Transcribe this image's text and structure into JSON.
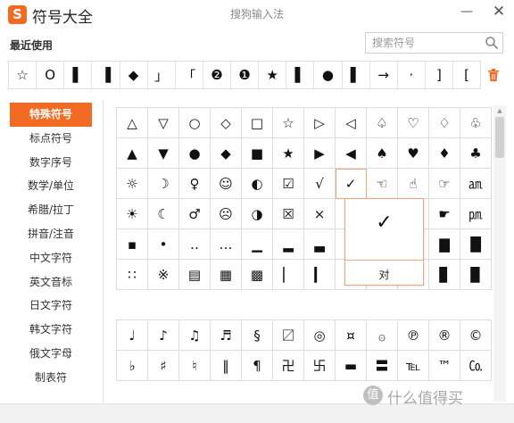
{
  "window": {
    "logo": "S",
    "title": "符号大全",
    "subtitle": "搜狗输入法",
    "minimize": "—",
    "close": "✕"
  },
  "recent": {
    "label": "最近使用",
    "symbols": [
      "☆",
      "O",
      "▌",
      "▐",
      "◆",
      "」",
      "「",
      "❷",
      "❶",
      "★",
      "▌",
      "●",
      "▌",
      "→",
      "·",
      "]",
      "["
    ]
  },
  "search": {
    "placeholder": "搜索符号",
    "value": ""
  },
  "categories": [
    "特殊符号",
    "标点符号",
    "数字序号",
    "数学/单位",
    "希腊/拉丁",
    "拼音/注音",
    "中文字符",
    "英文音标",
    "日文字符",
    "韩文字符",
    "俄文字母",
    "制表符"
  ],
  "active_category": 0,
  "grid": {
    "rows": [
      [
        "△",
        "▽",
        "○",
        "◇",
        "□",
        "☆",
        "▷",
        "◁",
        "♤",
        "♡",
        "♢",
        "♧"
      ],
      [
        "▲",
        "▼",
        "●",
        "◆",
        "■",
        "★",
        "▶",
        "◀",
        "♠",
        "♥",
        "♦",
        "♣"
      ],
      [
        "☼",
        "☽",
        "♀",
        "☺",
        "◐",
        "☑",
        "√",
        "✓",
        "☜",
        "☝",
        "☞",
        "㏂"
      ],
      [
        "☀",
        "☾",
        "♂",
        "☹",
        "◑",
        "☒",
        "×",
        "✗",
        "☚",
        "☟",
        "☛",
        "㏘"
      ],
      [
        "▪",
        "•",
        "‥",
        "…",
        "▁",
        "▂",
        "▃",
        "▄",
        "▅",
        "▆",
        "▇",
        "█"
      ],
      [
        "∷",
        "※",
        "▤",
        "▦",
        "▩",
        "▏",
        "▎",
        "▍",
        "▌",
        "▋",
        "▊",
        "▉"
      ]
    ],
    "selected": {
      "row": 2,
      "col": 7
    }
  },
  "grid2": {
    "rows": [
      [
        "♩",
        "♪",
        "♫",
        "♬",
        "§",
        "〼",
        "◎",
        "¤",
        "۞",
        "℗",
        "®",
        "©"
      ],
      [
        "♭",
        "♯",
        "♮",
        "‖",
        "¶",
        "卍",
        "卐",
        "▬",
        "〓",
        "℡",
        "™",
        "㏇"
      ]
    ]
  },
  "popup": {
    "symbol": "✓",
    "name": "对"
  },
  "watermark": {
    "badge": "值",
    "text": "什么值得买"
  }
}
